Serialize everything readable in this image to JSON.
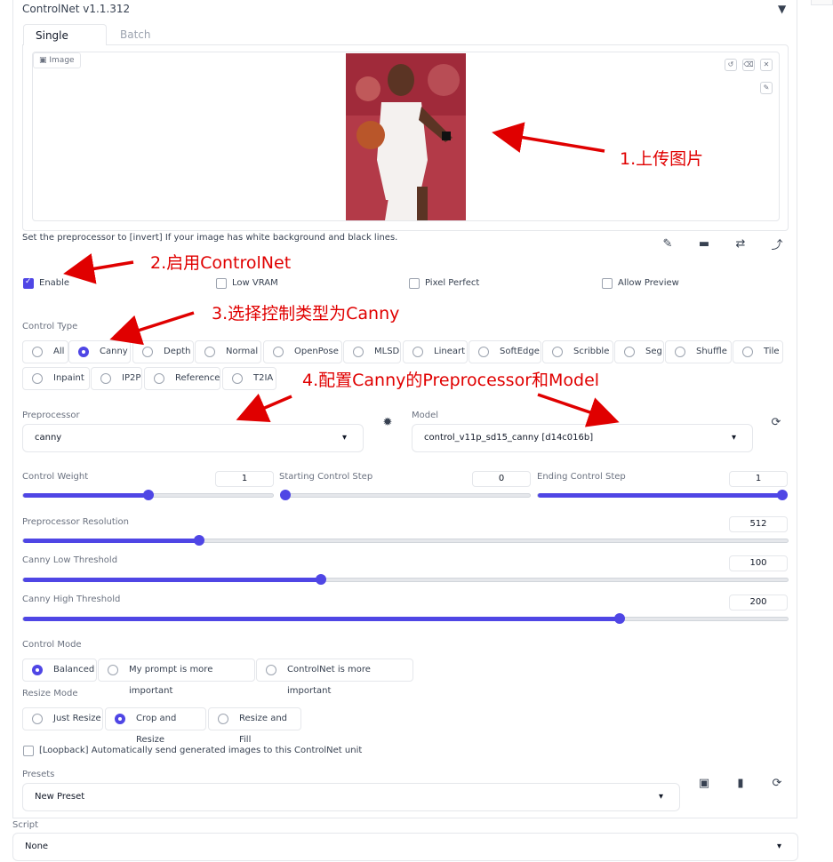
{
  "panel": {
    "title": "ControlNet v1.1.312",
    "collapse_icon": "triangle-down-icon"
  },
  "tabs": [
    {
      "label": "Single Image"
    },
    {
      "label": "Batch"
    }
  ],
  "image": {
    "label": "Image",
    "label_icon": "image-icon",
    "tools": [
      "undo-icon",
      "eraser-icon",
      "close-icon",
      "brush-icon"
    ]
  },
  "hint": "Set the preprocessor to [invert] If your image has white background and black lines.",
  "action_icons": [
    "edit-icon",
    "camera-icon",
    "swap-icon",
    "arrow-curve-icon"
  ],
  "checkboxes": {
    "enable": {
      "label": "Enable",
      "checked": true
    },
    "low_vram": {
      "label": "Low VRAM",
      "checked": false
    },
    "pixel_perfect": {
      "label": "Pixel Perfect",
      "checked": false
    },
    "allow_preview": {
      "label": "Allow Preview",
      "checked": false
    }
  },
  "control_type": {
    "label": "Control Type",
    "selected": "Canny",
    "row1": [
      "All",
      "Canny",
      "Depth",
      "Normal",
      "OpenPose",
      "MLSD",
      "Lineart",
      "SoftEdge",
      "Scribble",
      "Seg",
      "Shuffle",
      "Tile"
    ],
    "row2": [
      "Inpaint",
      "IP2P",
      "Reference",
      "T2IA"
    ]
  },
  "preprocessor": {
    "label": "Preprocessor",
    "value": "canny",
    "run_icon": "burst-icon"
  },
  "model": {
    "label": "Model",
    "value": "control_v11p_sd15_canny [d14c016b]",
    "refresh_icon": "refresh-icon"
  },
  "sliders": {
    "control_weight": {
      "label": "Control Weight",
      "value": "1",
      "fraction": 0.5
    },
    "starting_step": {
      "label": "Starting Control Step",
      "value": "0",
      "fraction": 0.0
    },
    "ending_step": {
      "label": "Ending Control Step",
      "value": "1",
      "fraction": 1.0
    },
    "preprocessor_resolution": {
      "label": "Preprocessor Resolution",
      "value": "512",
      "fraction": 0.23
    },
    "canny_low": {
      "label": "Canny Low Threshold",
      "value": "100",
      "fraction": 0.39
    },
    "canny_high": {
      "label": "Canny High Threshold",
      "value": "200",
      "fraction": 0.78
    }
  },
  "control_mode": {
    "label": "Control Mode",
    "options": [
      "Balanced",
      "My prompt is more important",
      "ControlNet is more important"
    ],
    "selected": "Balanced"
  },
  "resize_mode": {
    "label": "Resize Mode",
    "options": [
      "Just Resize",
      "Crop and Resize",
      "Resize and Fill"
    ],
    "selected": "Crop and Resize"
  },
  "loopback": {
    "label": "[Loopback] Automatically send generated images to this ControlNet unit",
    "checked": false
  },
  "presets": {
    "label": "Presets",
    "value": "New Preset",
    "icons": [
      "save-icon",
      "delete-icon",
      "refresh-icon"
    ]
  },
  "script": {
    "label": "Script",
    "value": "None"
  },
  "annotations": [
    "1.上传图片",
    "2.启用ControlNet",
    "3.选择控制类型为Canny",
    "4.配置Canny的Preprocessor和Model"
  ],
  "colors": {
    "accent": "#4f46e5",
    "annotation": "#e00000"
  }
}
